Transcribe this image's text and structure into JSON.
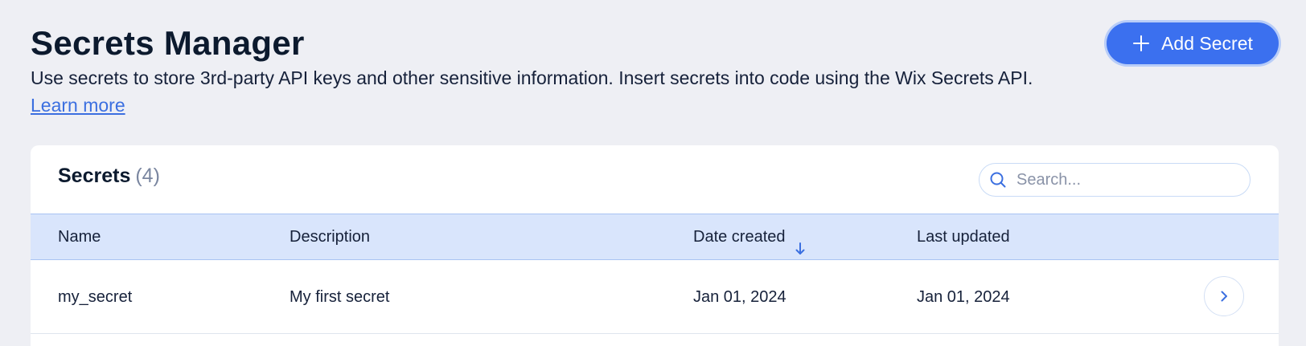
{
  "header": {
    "title": "Secrets Manager",
    "description": "Use secrets to store 3rd-party API keys and other sensitive information. Insert secrets into code using the Wix Secrets API.",
    "learn_more": "Learn more",
    "add_button": "Add Secret"
  },
  "secrets_card": {
    "title": "Secrets",
    "count": "(4)",
    "search_placeholder": "Search...",
    "columns": [
      "Name",
      "Description",
      "Date created",
      "Last updated"
    ],
    "sorted_column": "Date created",
    "rows": [
      {
        "name": "my_secret",
        "description": "My first secret",
        "date_created": "Jan 01, 2024",
        "last_updated": "Jan 01, 2024"
      }
    ]
  },
  "icons": {
    "add": "plus-icon",
    "search": "search-icon",
    "sort": "arrow-down-icon",
    "row_open": "chevron-right-icon"
  },
  "colors": {
    "accent": "#3b70ef",
    "link": "#3b6fe0",
    "page_background": "#eeeff4",
    "table_header_background": "#d9e5fc"
  }
}
